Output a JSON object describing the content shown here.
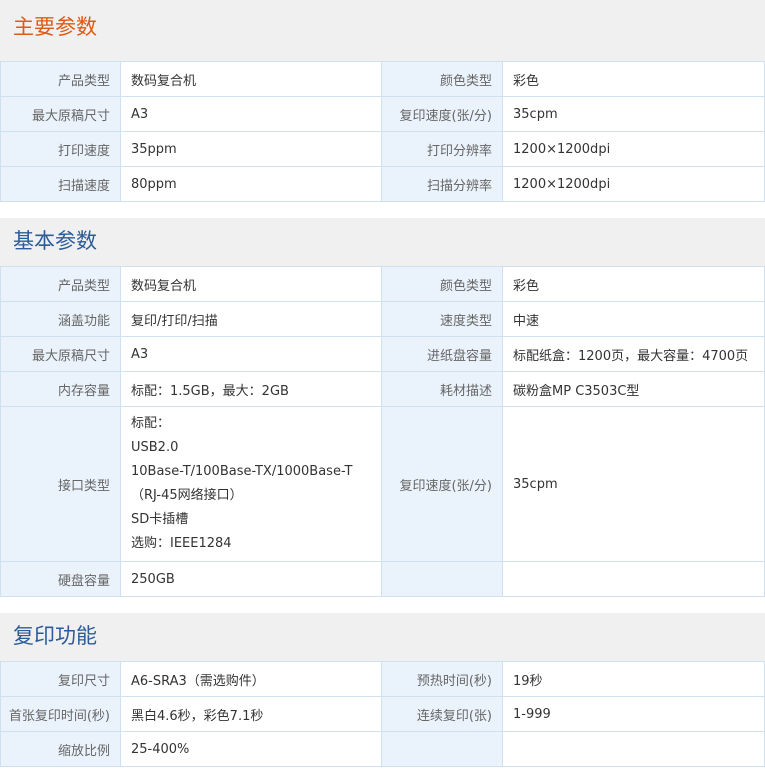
{
  "sections": [
    {
      "title": "主要参数",
      "title_color": "#e05a12",
      "rows": [
        {
          "l1": "产品类型",
          "v1": "数码复合机",
          "l2": "颜色类型",
          "v2": "彩色"
        },
        {
          "l1": "最大原稿尺寸",
          "v1": "A3",
          "l2": "复印速度(张/分)",
          "v2": "35cpm"
        },
        {
          "l1": "打印速度",
          "v1": "35ppm",
          "l2": "打印分辨率",
          "v2": "1200×1200dpi"
        },
        {
          "l1": "扫描速度",
          "v1": "80ppm",
          "l2": "扫描分辨率",
          "v2": "1200×1200dpi"
        }
      ]
    },
    {
      "title": "基本参数",
      "title_color": "#2b5c99",
      "rows": [
        {
          "l1": "产品类型",
          "v1": "数码复合机",
          "l2": "颜色类型",
          "v2": "彩色"
        },
        {
          "l1": "涵盖功能",
          "v1": "复印/打印/扫描",
          "l2": "速度类型",
          "v2": "中速"
        },
        {
          "l1": "最大原稿尺寸",
          "v1": "A3",
          "l2": "进纸盘容量",
          "v2": "标配纸盒：1200页，最大容量：4700页"
        },
        {
          "l1": "内存容量",
          "v1": "标配：1.5GB，最大：2GB",
          "l2": "耗材描述",
          "v2": "碳粉盒MP C3503C型"
        },
        {
          "l1": "接口类型",
          "v1_lines": [
            "标配：",
            "USB2.0",
            "10Base-T/100Base-TX/1000Base-T",
            "（RJ-45网络接口）",
            "SD卡插槽",
            "选购：IEEE1284"
          ],
          "l2": "复印速度(张/分)",
          "v2": "35cpm"
        },
        {
          "l1": "硬盘容量",
          "v1": "250GB",
          "l2": "",
          "v2": ""
        }
      ]
    },
    {
      "title": "复印功能",
      "title_color": "#2b5c99",
      "rows": [
        {
          "l1": "复印尺寸",
          "v1": "A6-SRA3（需选购件）",
          "l2": "预热时间(秒)",
          "v2": "19秒"
        },
        {
          "l1": "首张复印时间(秒)",
          "v1": "黑白4.6秒，彩色7.1秒",
          "l2": "连续复印(张)",
          "v2": "1-999"
        },
        {
          "l1": "缩放比例",
          "v1": "25-400%",
          "l2": "",
          "v2": ""
        }
      ]
    }
  ]
}
